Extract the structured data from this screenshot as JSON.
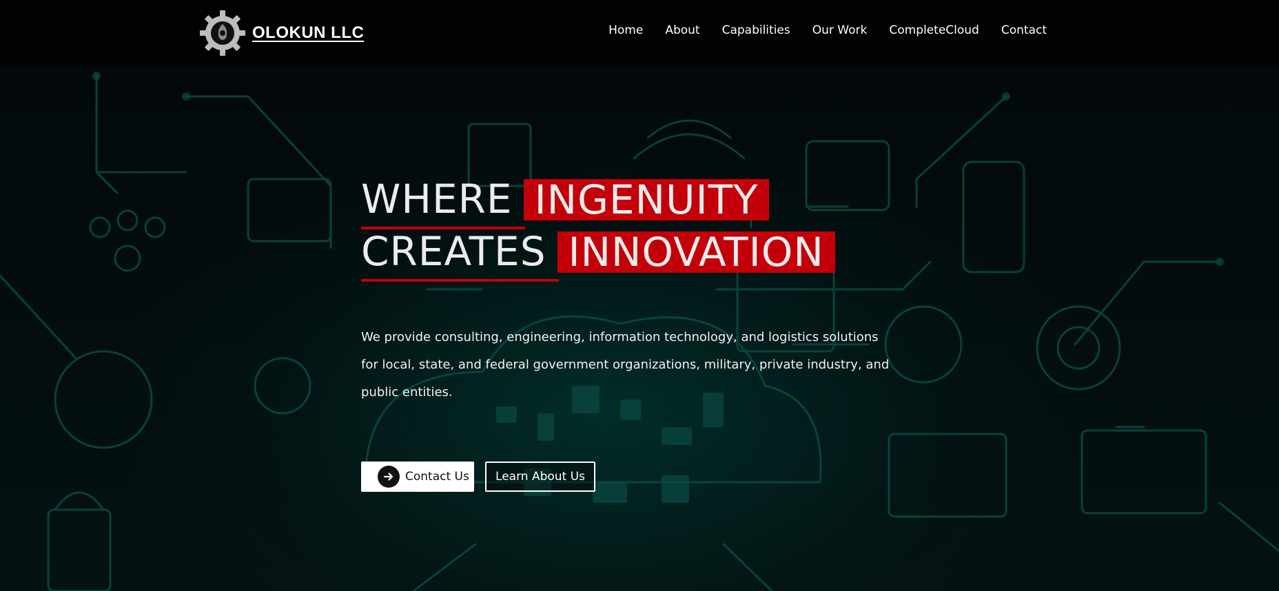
{
  "brand": {
    "name": "OLOKUN LLC",
    "logo_icon": "gear-logo-icon"
  },
  "nav": {
    "items": [
      {
        "label": "Home"
      },
      {
        "label": "About"
      },
      {
        "label": "Capabilities"
      },
      {
        "label": "Our Work"
      },
      {
        "label": "CompleteCloud"
      },
      {
        "label": "Contact"
      }
    ]
  },
  "hero": {
    "line1_plain": "WHERE",
    "line1_highlight": "INGENUITY",
    "line2_plain": "CREATES",
    "line2_highlight": "INNOVATION",
    "description": "We provide consulting, engineering, information technology, and logistics solutions for local, state, and federal government organizations, military, private industry, and public entities.",
    "primary_button": "Contact Us",
    "primary_button_icon": "arrow-right-icon",
    "secondary_button": "Learn About Us"
  },
  "colors": {
    "accent": "#c3000a",
    "background": "#020608",
    "circuit_glow": "#0a4a44"
  }
}
